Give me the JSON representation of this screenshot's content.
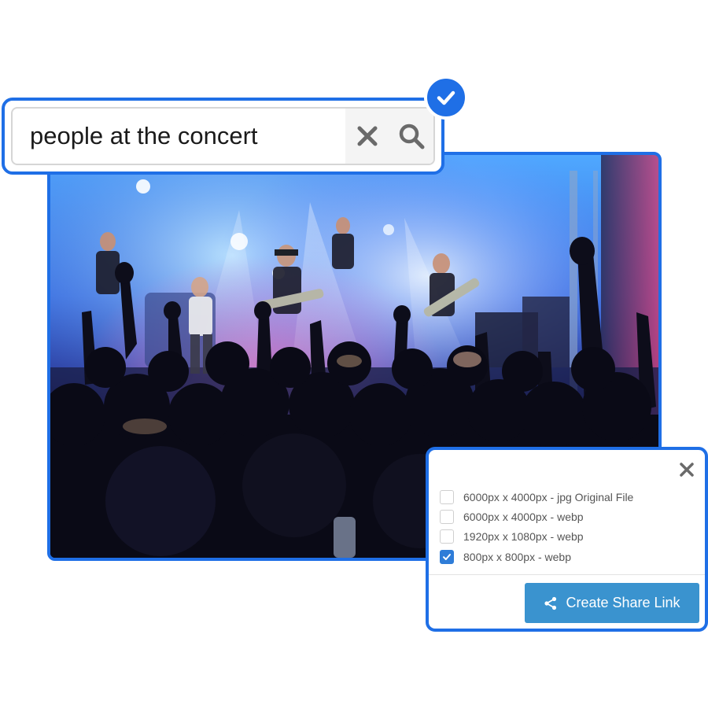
{
  "search": {
    "query": "people at the concert",
    "clear_icon": "close-icon",
    "search_icon": "search-icon",
    "status_icon": "check-icon"
  },
  "photo": {
    "subject": "concert-crowd-photo"
  },
  "share_panel": {
    "close_icon": "close-icon",
    "options": [
      {
        "label": "6000px x 4000px - jpg Original File",
        "checked": false
      },
      {
        "label": "6000px x 4000px - webp",
        "checked": false
      },
      {
        "label": "1920px x 1080px - webp",
        "checked": false
      },
      {
        "label": "800px x 800px - webp",
        "checked": true
      }
    ],
    "button_label": "Create Share Link",
    "button_icon": "share-icon"
  },
  "colors": {
    "accent_border": "#1f6fe6",
    "button": "#3a93cf",
    "checkbox_checked": "#2f7dd8"
  }
}
